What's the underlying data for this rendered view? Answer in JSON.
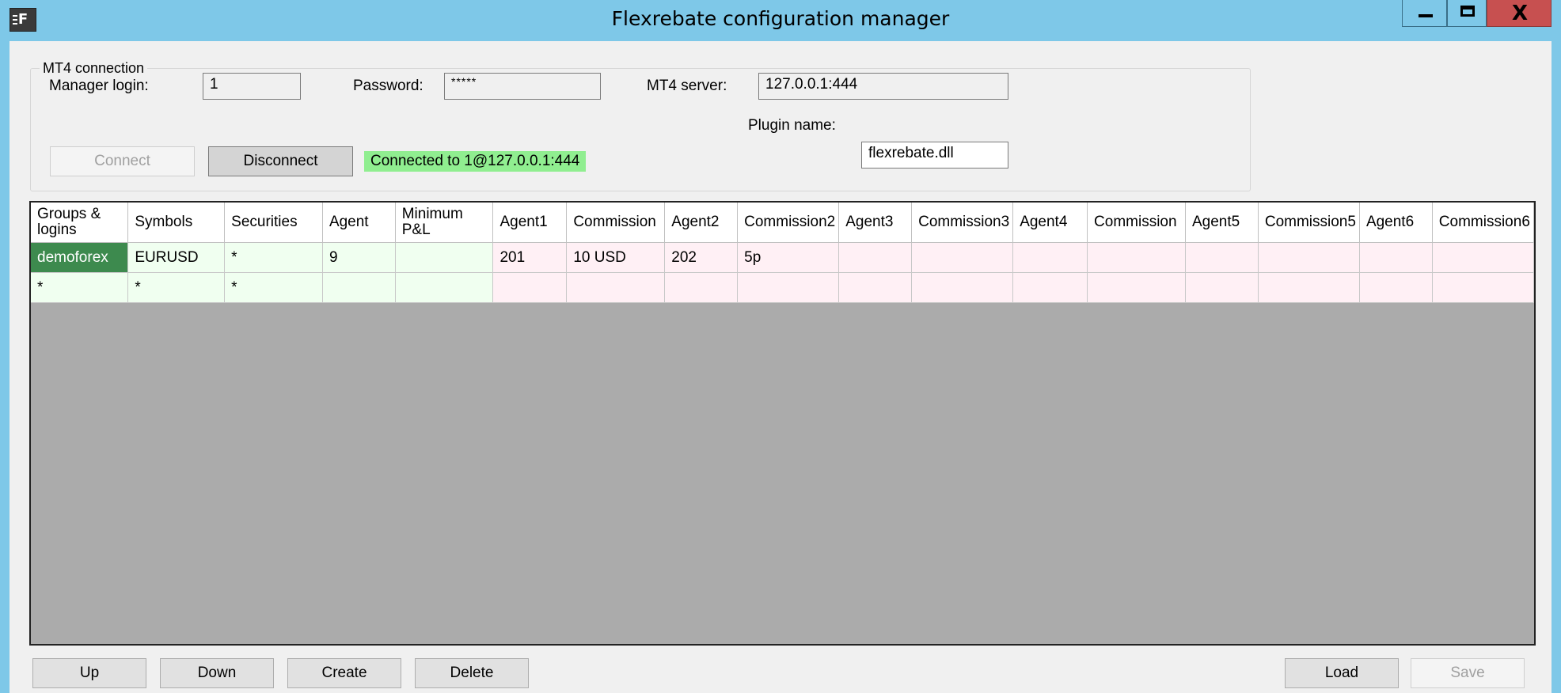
{
  "window": {
    "title": "Flexrebate configuration manager",
    "icon": "flexrebate-app-icon",
    "controls": {
      "minimize": "minimize-icon",
      "maximize": "maximize-icon",
      "close_glyph": "X"
    }
  },
  "connection": {
    "group_title": "MT4 connection",
    "manager_login_label": "Manager login:",
    "manager_login_value": "1",
    "password_label": "Password:",
    "password_value": "*****",
    "server_label": "MT4 server:",
    "server_value": "127.0.0.1:444",
    "plugin_label": "Plugin name:",
    "plugin_value": "flexrebate.dll",
    "connect_label": "Connect",
    "disconnect_label": "Disconnect",
    "status_text": "Connected to 1@127.0.0.1:444",
    "status_color": "#90ee90"
  },
  "grid": {
    "columns": [
      {
        "label": "Groups & logins"
      },
      {
        "label": "Symbols"
      },
      {
        "label": "Securities"
      },
      {
        "label": "Agent"
      },
      {
        "label": "Minimum P&L"
      },
      {
        "label": "Agent1"
      },
      {
        "label": "Commission"
      },
      {
        "label": "Agent2"
      },
      {
        "label": "Commission2"
      },
      {
        "label": "Agent3"
      },
      {
        "label": "Commission3"
      },
      {
        "label": "Agent4"
      },
      {
        "label": "Commission"
      },
      {
        "label": "Agent5"
      },
      {
        "label": "Commission5"
      },
      {
        "label": "Agent6"
      },
      {
        "label": "Commission6"
      }
    ],
    "rows": [
      [
        "demoforex",
        "EURUSD",
        "*",
        "9",
        "",
        "201",
        "10 USD",
        "202",
        "5p",
        "",
        "",
        "",
        "",
        "",
        "",
        "",
        ""
      ],
      [
        "*",
        "*",
        "*",
        "",
        "",
        "",
        "",
        "",
        "",
        "",
        "",
        "",
        "",
        "",
        "",
        "",
        ""
      ]
    ],
    "colors": {
      "rule_columns": "#f0fff0",
      "agent_columns": "#fff0f5",
      "selected_cell": "#3d8a4e",
      "empty_area": "#ababab"
    }
  },
  "actions": {
    "up": "Up",
    "down": "Down",
    "create": "Create",
    "delete": "Delete",
    "load": "Load",
    "save": "Save"
  }
}
